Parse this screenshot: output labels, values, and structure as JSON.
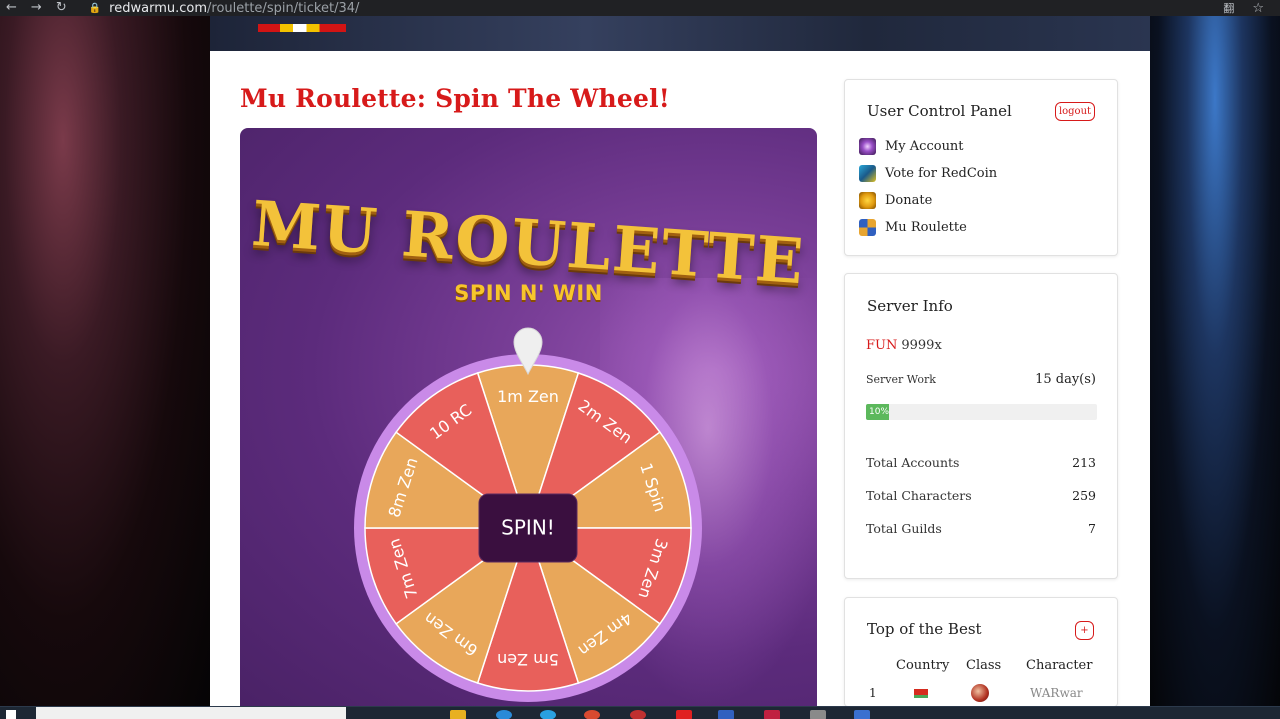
{
  "browser": {
    "nav": {
      "back": "←",
      "forward": "→",
      "reload": "↻"
    },
    "lock_icon": "lock-icon",
    "url_host": "redwarmu.com",
    "url_path": "/roulette/spin/ticket/34/",
    "translate_icon": "翻",
    "star_icon": "☆"
  },
  "page": {
    "title": "Mu Roulette: Spin The Wheel!"
  },
  "roulette": {
    "logo_title": "MU ROULETTE",
    "logo_subtitle": "SPIN N' WIN",
    "spin_label": "SPIN!",
    "segments": [
      {
        "label": "1m Zen",
        "color": "#e8a75a"
      },
      {
        "label": "2m Zen",
        "color": "#e8605b"
      },
      {
        "label": "1 Spin",
        "color": "#e8a75a"
      },
      {
        "label": "3m Zen",
        "color": "#e8605b"
      },
      {
        "label": "4m Zen",
        "color": "#e8a75a"
      },
      {
        "label": "5m Zen",
        "color": "#e8605b"
      },
      {
        "label": "6m Zen",
        "color": "#e8a75a"
      },
      {
        "label": "7m Zen",
        "color": "#e8605b"
      },
      {
        "label": "8m Zen",
        "color": "#e8a75a"
      },
      {
        "label": "10 RC",
        "color": "#e8605b"
      }
    ],
    "rim_color": "#c98ae8",
    "hub_color": "#3a0f3f"
  },
  "sidebar": {
    "control_panel": {
      "title": "User Control Panel",
      "logout_label": "logout",
      "items": [
        {
          "label": "My Account",
          "icon": "account-icon"
        },
        {
          "label": "Vote for RedCoin",
          "icon": "vote-icon"
        },
        {
          "label": "Donate",
          "icon": "donate-icon"
        },
        {
          "label": "Mu Roulette",
          "icon": "roulette-icon"
        }
      ]
    },
    "server_info": {
      "title": "Server Info",
      "server_name": "FUN",
      "server_rate": "9999x",
      "work_label": "Server Work",
      "work_value": "15 day(s)",
      "progress_label": "10%",
      "progress_percent": 10,
      "stats": [
        {
          "label": "Total Accounts",
          "value": "213"
        },
        {
          "label": "Total Characters",
          "value": "259"
        },
        {
          "label": "Total Guilds",
          "value": "7"
        }
      ]
    },
    "top_best": {
      "title": "Top of the Best",
      "plus_label": "+",
      "headers": {
        "country": "Country",
        "class": "Class",
        "character": "Character"
      },
      "rows": [
        {
          "rank": "1",
          "character": "WARwar"
        }
      ]
    }
  }
}
